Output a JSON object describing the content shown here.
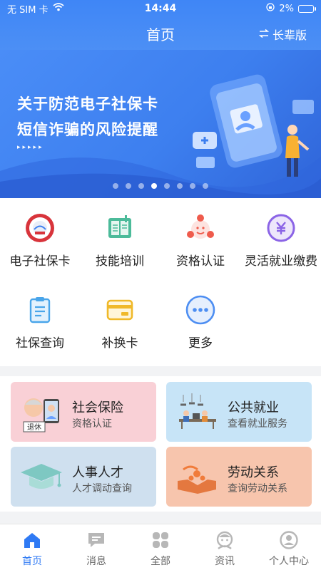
{
  "status_bar": {
    "carrier": "无 SIM 卡",
    "time": "14:44",
    "battery": "2%"
  },
  "header": {
    "title": "首页",
    "mode_switch": "长辈版"
  },
  "banner": {
    "line1": "关于防范电子社保卡",
    "line2": "短信诈骗的风险提醒",
    "arrows": "▸▸▸▸▸",
    "slide_count": 8,
    "active_slide": 4
  },
  "services": [
    {
      "label": "电子社保卡",
      "icon": "social-security-card-icon"
    },
    {
      "label": "技能培训",
      "icon": "training-book-icon"
    },
    {
      "label": "资格认证",
      "icon": "face-verification-icon"
    },
    {
      "label": "灵活就业缴费",
      "icon": "yuan-payment-icon"
    },
    {
      "label": "社保查询",
      "icon": "clipboard-icon"
    },
    {
      "label": "补换卡",
      "icon": "card-icon"
    },
    {
      "label": "更多",
      "icon": "more-icon"
    }
  ],
  "cards": [
    {
      "title": "社会保险",
      "subtitle": "资格认证",
      "badge": "退休",
      "color": "#f9d0d6"
    },
    {
      "title": "公共就业",
      "subtitle": "查看就业服务",
      "color": "#c7e4f7"
    },
    {
      "title": "人事人才",
      "subtitle": "人才调动查询",
      "color": "#cfe0ef"
    },
    {
      "title": "劳动关系",
      "subtitle": "查询劳动关系",
      "color": "#f7c5ad"
    }
  ],
  "tabs": [
    {
      "label": "首页",
      "icon": "home-icon",
      "active": true
    },
    {
      "label": "消息",
      "icon": "message-icon",
      "active": false
    },
    {
      "label": "全部",
      "icon": "grid-icon",
      "active": false
    },
    {
      "label": "资讯",
      "icon": "news-icon",
      "active": false
    },
    {
      "label": "个人中心",
      "icon": "profile-icon",
      "active": false
    }
  ],
  "colors": {
    "primary": "#3f86f6",
    "tab_active": "#2f7af4"
  }
}
